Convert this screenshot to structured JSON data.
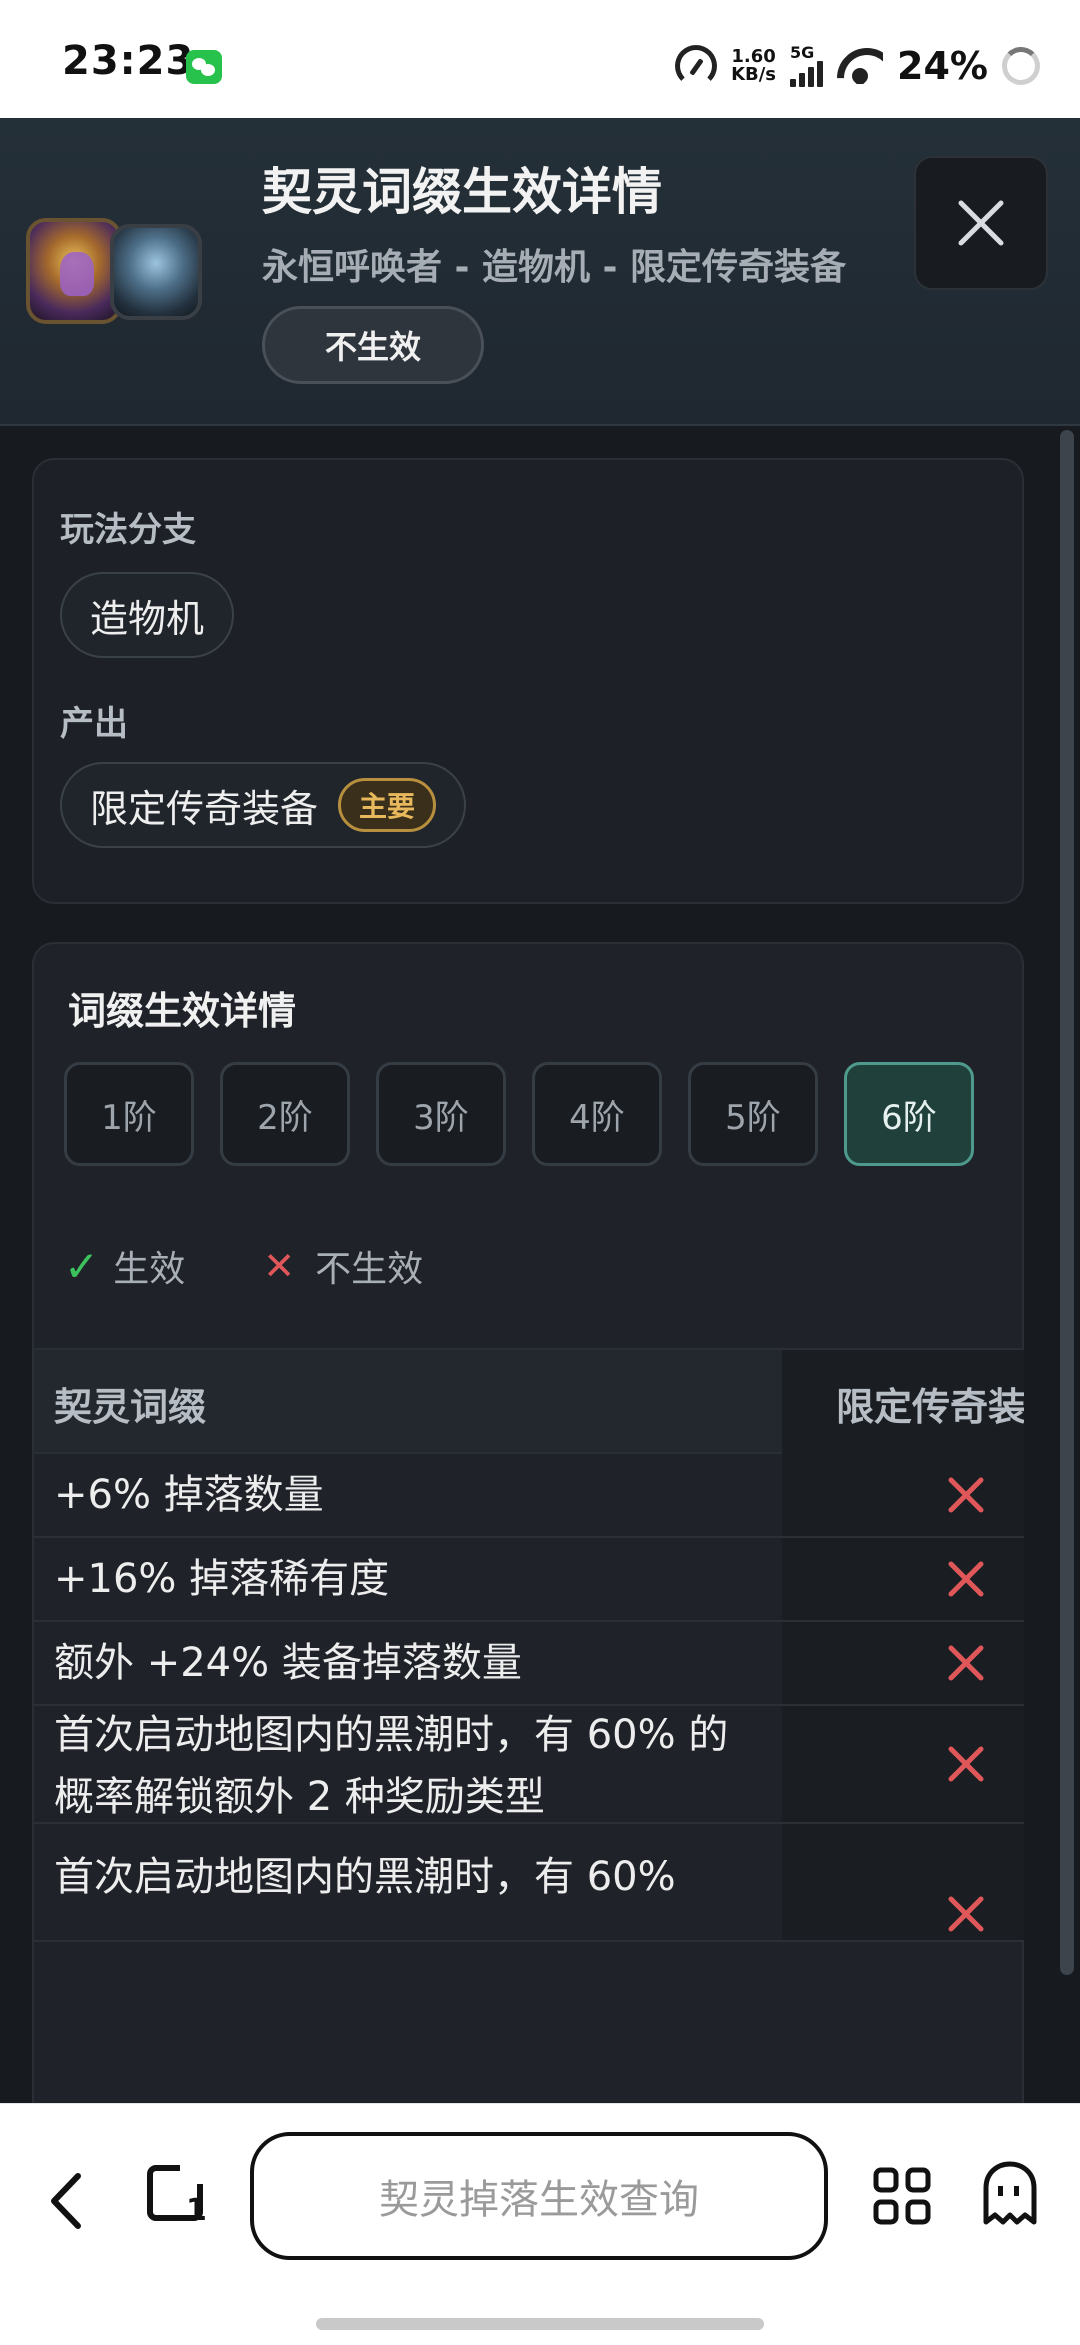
{
  "status_bar": {
    "time": "23:23",
    "net_speed_value": "1.60",
    "net_speed_unit": "KB/s",
    "network_type": "5G",
    "battery": "24%"
  },
  "header": {
    "title": "契灵词缀生效详情",
    "subtitle": "永恒呼唤者 - 造物机 - 限定传奇装备",
    "status": "不生效"
  },
  "branch": {
    "label": "玩法分支",
    "value": "造物机"
  },
  "output": {
    "label": "产出",
    "value": "限定传奇装备",
    "badge": "主要"
  },
  "details": {
    "title": "词缀生效详情",
    "tiers": [
      "1阶",
      "2阶",
      "3阶",
      "4阶",
      "5阶",
      "6阶"
    ],
    "active_tier": "6阶",
    "legend_effective": "生效",
    "legend_ineffective": "不生效",
    "columns": [
      "契灵词缀",
      "限定传奇装备"
    ],
    "rows": [
      {
        "affix": "+6% 掉落数量",
        "effective": false
      },
      {
        "affix": "+16% 掉落稀有度",
        "effective": false
      },
      {
        "affix": "额外 +24% 装备掉落数量",
        "effective": false
      },
      {
        "affix": "首次启动地图内的黑潮时，有 60% 的概率解锁额外 2 种奖励类型",
        "effective": false
      },
      {
        "affix": "首次启动地图内的黑潮时，有 60%",
        "effective": false
      }
    ]
  },
  "bottom_nav": {
    "search_text": "契灵掉落生效查询",
    "tab_count": "1"
  },
  "colors": {
    "accent_active": "#20403c",
    "effective": "#3cc25b",
    "ineffective": "#e0575a",
    "badge_gold": "#e8b95c"
  }
}
